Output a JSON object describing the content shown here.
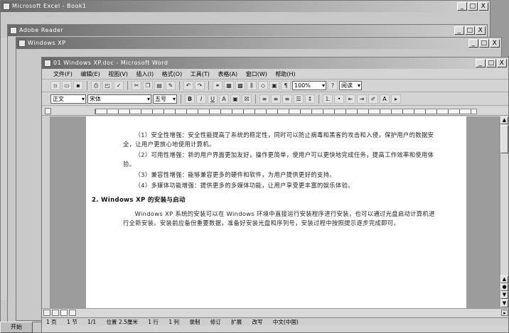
{
  "windows": {
    "excel": {
      "title": "Microsoft Excel - Book1"
    },
    "reader": {
      "title": "Adobe Reader"
    },
    "explorer": {
      "title": "Windows XP"
    },
    "word": {
      "title": "01 Windows XP.doc - Microsoft Word"
    }
  },
  "controls": {
    "minimize": "_",
    "maximize": "□",
    "close": "X"
  },
  "word": {
    "menu": [
      "文件(F)",
      "编辑(E)",
      "视图(V)",
      "插入(I)",
      "格式(O)",
      "工具(T)",
      "表格(A)",
      "窗口(W)",
      "帮助(H)"
    ],
    "formatting": {
      "style": "正文",
      "font": "宋体",
      "size": "五号",
      "zoom": "100%",
      "read_label": "阅读"
    },
    "document": {
      "paragraphs": [
        "（1）安全性增强：安全性能提高了系统的稳定性，同时可以防止病毒和黑客的攻击和入侵，保护用户的数据安全，让用户更放心地使用计算机。",
        "（2）可用性增强：新的用户界面更加友好，操作更简单，使用户可以更快地完成任务，提高工作效率和使用体验。",
        "（3）兼容性增强：能够兼容更多的硬件和软件，为用户提供更好的支持。",
        "（4）多媒体功能增强：提供更多的多媒体功能，让用户享受更丰富的娱乐体验。"
      ],
      "heading": "2. Windows XP 的安装与启动",
      "tail": "Windows XP 系统的安装可以在 Windows 环境中直接运行安装程序进行安装，也可以通过光盘启动计算机进行全新安装。安装前应备份重要数据，准备好安装光盘和序列号，安装过程中按照提示逐步完成即可。"
    },
    "status": [
      "1 页",
      "1 节",
      "1/1",
      "位置 2.5厘米",
      "1 行",
      "1 列",
      "录制",
      "修订",
      "扩展",
      "改写",
      "中文(中国)"
    ]
  },
  "taskbar": {
    "start": "开始"
  }
}
